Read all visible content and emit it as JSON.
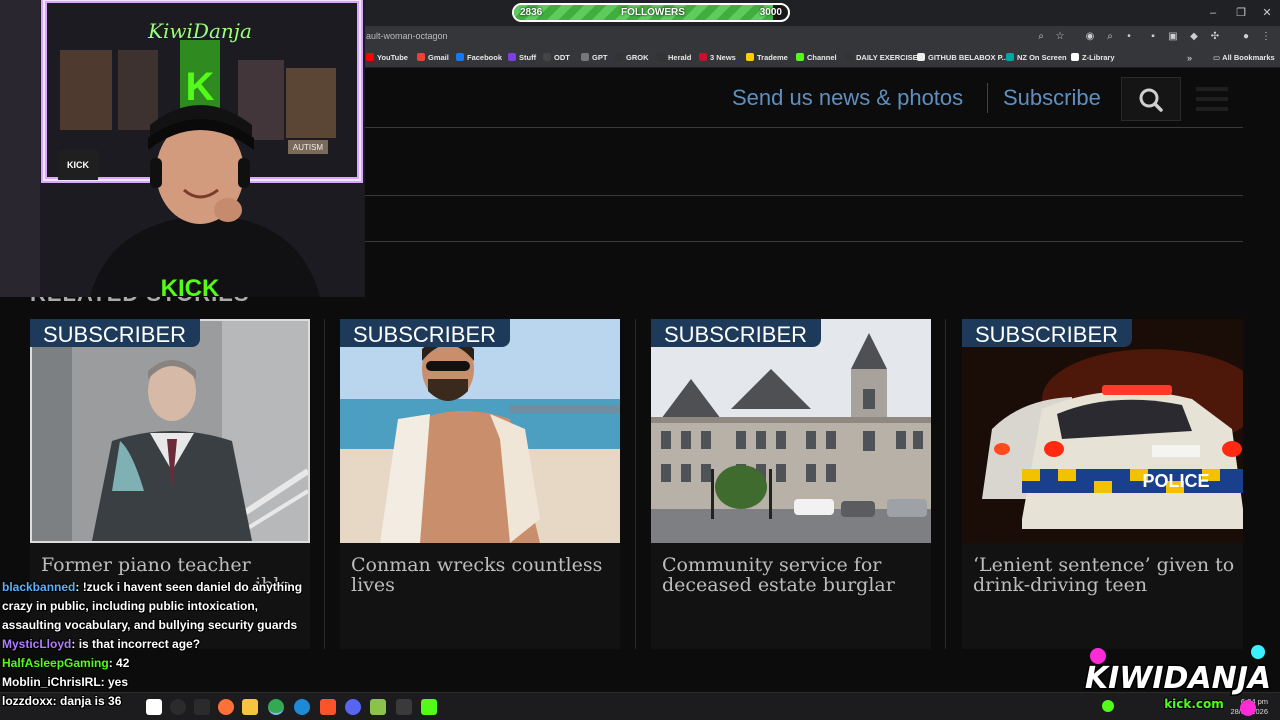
{
  "followers": {
    "label": "FOLLOWERS",
    "current": "2836",
    "goal": "3000",
    "progress": 0.9453
  },
  "browser": {
    "url": "ault-woman-octagon",
    "bookmarks": [
      "YouTube",
      "Gmail",
      "Facebook",
      "Stuff",
      "ODT",
      "GPT",
      "GROK",
      "Herald",
      "3 News",
      "Trademe",
      "Channel",
      "DAILY EXERCISE!",
      "GITHUB BELABOX P...",
      "NZ On Screen",
      "Z-Library"
    ],
    "all_bookmarks": "All Bookmarks",
    "bookmark_colors": [
      "#ff0000",
      "#ea4335",
      "#1877f2",
      "#7b3fe4",
      "#444444",
      "#777777",
      "#333333",
      "#333333",
      "#c8102e",
      "#ffcc00",
      "#53fc18",
      "#333333",
      "#eeeeee",
      "#00a6a6",
      "#ffffff"
    ]
  },
  "site_nav": {
    "send_news": "Send us news & photos",
    "subscribe": "Subscribe"
  },
  "related_heading": "RELATED STORIES",
  "cards": [
    {
      "badge": "SUBSCRIBER",
      "title": "Former piano teacher ... [obscured by overlay] ...",
      "title_line1": "Former piano teacher",
      "title_line2": "...ible"
    },
    {
      "badge": "SUBSCRIBER",
      "title": "Conman wrecks countless lives"
    },
    {
      "badge": "SUBSCRIBER",
      "title": "Community service for deceased estate burglar"
    },
    {
      "badge": "SUBSCRIBER",
      "title": "‘Lenient sentence’ given to drink-driving teen"
    }
  ],
  "chat": [
    {
      "user": "blackbanned",
      "color": "#5ab0ff",
      "text": ": !zuck i havent seen daniel do anything crazy in public, including public intoxication, assaulting vocabulary, and bullying security guards"
    },
    {
      "user": "MysticLloyd",
      "color": "#b07cff",
      "text": ": is that incorrect age?"
    },
    {
      "user": "HalfAsleepGaming",
      "color": "#53fc18",
      "text": ": 42"
    },
    {
      "user": "Moblin_iChrisIRL",
      "color": "#ffffff",
      "text": ": yes"
    },
    {
      "user": "lozzdoxx",
      "color": "#ffffff",
      "text": ": danja is 36"
    }
  ],
  "webcam": {
    "neon_sign": "KiwiDanja",
    "shirt_text": "KICK",
    "box_text": "KICK",
    "sticker": "AUTISM"
  },
  "logo": {
    "main": "KIWIDANJA",
    "sub": "kick.com"
  },
  "taskbar": {
    "time": "6:34 pm",
    "date": "28/02/2026"
  },
  "colors": {
    "nav_blue": "#5f8fbf",
    "badge_bg": "#1e3a5a",
    "kick_green": "#53fc18"
  }
}
